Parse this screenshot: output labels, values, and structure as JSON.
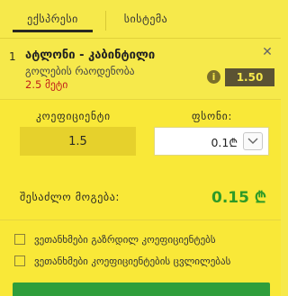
{
  "tabs": [
    {
      "label": "ექსპრესი",
      "active": true
    },
    {
      "label": "სისტემა",
      "active": false
    }
  ],
  "bet": {
    "index": "1",
    "title": "ატლონი - კაბინტილი",
    "market": "გოლების რაოდენობა",
    "selection": "2.5 მეტი",
    "odds": "1.50",
    "info_icon_text": "i",
    "close_icon": "close-icon"
  },
  "form": {
    "odds_label": "კოეფიციენტი",
    "stake_label": "ფსონი:",
    "odds_value": "1.5",
    "stake_value": "0.1₾"
  },
  "possible_win": {
    "label": "შესაძლო მოგება:",
    "value": "0.15 ₾",
    "color": "#2e9a27"
  },
  "options": [
    {
      "label": "ვეთანხმები გაზრდილ კოეფიციენტებს",
      "checked": false
    },
    {
      "label": "ვეთანხმები კოეფიციენტების ცვლილებას",
      "checked": false
    }
  ],
  "colors": {
    "background": "#f6e94b",
    "badge": "#5b5333",
    "selection": "#c0201a",
    "submit": "#2f9e3b"
  }
}
